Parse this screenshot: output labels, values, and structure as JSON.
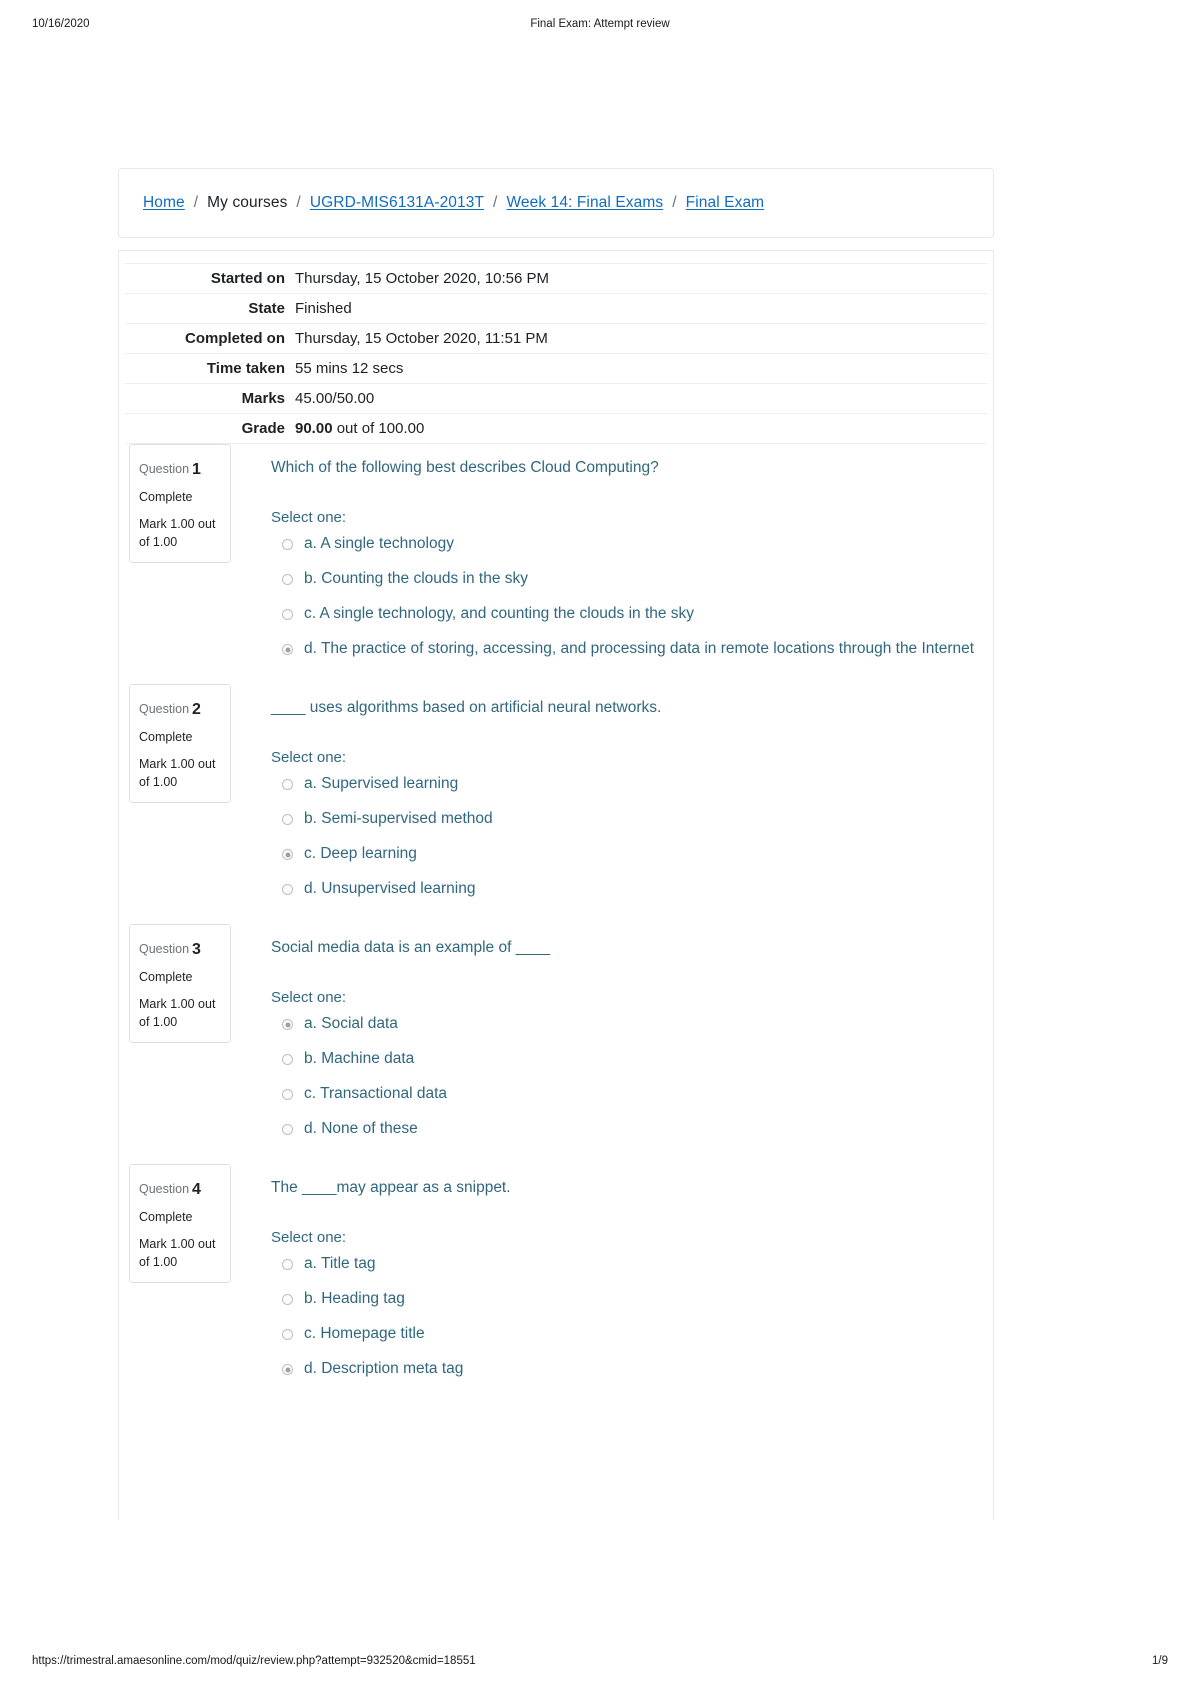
{
  "print_header": {
    "date": "10/16/2020",
    "title": "Final Exam: Attempt review"
  },
  "print_footer": {
    "url": "https://trimestral.amaesonline.com/mod/quiz/review.php?attempt=932520&cmid=18551",
    "page": "1/9"
  },
  "breadcrumb": {
    "items": [
      {
        "label": "Home",
        "link": true
      },
      {
        "label": "My courses",
        "link": false
      },
      {
        "label": "UGRD-MIS6131A-2013T",
        "link": true
      },
      {
        "label": "Week 14: Final Exams",
        "link": true
      },
      {
        "label": "Final Exam",
        "link": true
      }
    ],
    "separator": "/"
  },
  "summary": {
    "rows": [
      {
        "label": "Started on",
        "value": "Thursday, 15 October 2020, 10:56 PM"
      },
      {
        "label": "State",
        "value": "Finished"
      },
      {
        "label": "Completed on",
        "value": "Thursday, 15 October 2020, 11:51 PM"
      },
      {
        "label": "Time taken",
        "value": "55 mins 12 secs"
      },
      {
        "label": "Marks",
        "value": "45.00/50.00"
      }
    ],
    "grade": {
      "label": "Grade",
      "value_strong": "90.00",
      "value_rest": " out of 100.00"
    }
  },
  "questions": [
    {
      "info": {
        "number_label": "Question",
        "number": "1",
        "state": "Complete",
        "mark": "Mark 1.00 out of 1.00"
      },
      "text": "Which of the following best describes Cloud Computing?",
      "select_label": "Select one:",
      "options": [
        {
          "label": "a. A single technology",
          "selected": false
        },
        {
          "label": "b. Counting the clouds in the sky",
          "selected": false
        },
        {
          "label": "c. A single technology, and counting the clouds in the sky",
          "selected": false
        },
        {
          "label": "d. The practice of storing, accessing, and processing data in remote locations through the Internet",
          "selected": true
        }
      ]
    },
    {
      "info": {
        "number_label": "Question",
        "number": "2",
        "state": "Complete",
        "mark": "Mark 1.00 out of 1.00"
      },
      "text": "____ uses algorithms based on artificial neural networks.",
      "select_label": "Select one:",
      "options": [
        {
          "label": "a. Supervised learning",
          "selected": false
        },
        {
          "label": "b. Semi-supervised method",
          "selected": false
        },
        {
          "label": "c. Deep learning",
          "selected": true
        },
        {
          "label": "d. Unsupervised learning",
          "selected": false
        }
      ]
    },
    {
      "info": {
        "number_label": "Question",
        "number": "3",
        "state": "Complete",
        "mark": "Mark 1.00 out of 1.00"
      },
      "text": "Social media data is an example of ____",
      "select_label": "Select one:",
      "options": [
        {
          "label": "a. Social data",
          "selected": true
        },
        {
          "label": "b. Machine data",
          "selected": false
        },
        {
          "label": "c. Transactional data",
          "selected": false
        },
        {
          "label": "d. None of these",
          "selected": false
        }
      ]
    },
    {
      "info": {
        "number_label": "Question",
        "number": "4",
        "state": "Complete",
        "mark": "Mark 1.00 out of 1.00"
      },
      "text": "The ____may appear as a snippet.",
      "select_label": "Select one:",
      "options": [
        {
          "label": "a. Title tag",
          "selected": false
        },
        {
          "label": "b. Heading tag",
          "selected": false
        },
        {
          "label": "c. Homepage title",
          "selected": false
        },
        {
          "label": "d. Description meta tag",
          "selected": true
        }
      ]
    }
  ],
  "colors": {
    "link": "#0f6cbf",
    "question_text": "#30677e",
    "border": "#e6e9ec"
  }
}
